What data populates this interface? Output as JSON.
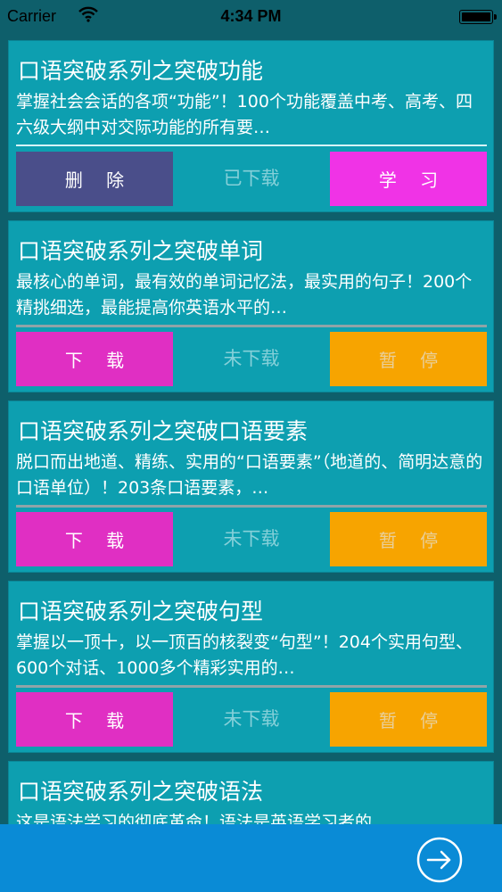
{
  "status_bar": {
    "carrier": "Carrier",
    "time": "4:34 PM"
  },
  "courses": [
    {
      "title": "口语突破系列之突破功能",
      "description": "掌握社会会话的各项“功能”！100个功能覆盖中考、高考、四六级大纲中对交际功能的所有要…",
      "left_button": "删 除",
      "status": "已下载",
      "right_button": "学 习"
    },
    {
      "title": "口语突破系列之突破单词",
      "description": "最核心的单词，最有效的单词记忆法，最实用的句子！200个精挑细选，最能提高你英语水平的…",
      "left_button": "下 载",
      "status": "未下载",
      "right_button": "暂 停"
    },
    {
      "title": "口语突破系列之突破口语要素",
      "description": "脱口而出地道、精练、实用的“口语要素”（地道的、简明达意的口语单位）！203条口语要素，…",
      "left_button": "下 载",
      "status": "未下载",
      "right_button": "暂 停"
    },
    {
      "title": "口语突破系列之突破句型",
      "description": "掌握以一顶十，以一顶百的核裂变“句型”！204个实用句型、600个对话、1000多个精彩实用的…",
      "left_button": "下 载",
      "status": "未下载",
      "right_button": "暂 停"
    },
    {
      "title": "口语突破系列之突破语法",
      "description": "这是语法学习的彻底革命！语法是英语学习者的…",
      "left_button": "",
      "status": "",
      "right_button": ""
    }
  ],
  "icons": {
    "next": "arrow-right-circle-icon",
    "wifi": "wifi-icon",
    "battery": "battery-icon"
  },
  "colors": {
    "card_bg": "#0d9fb0",
    "delete": "#4a4e8a",
    "study": "#f033e6",
    "download": "#e02fc3",
    "pause": "#f7a400",
    "bottom_bar": "#0a8bd6"
  }
}
